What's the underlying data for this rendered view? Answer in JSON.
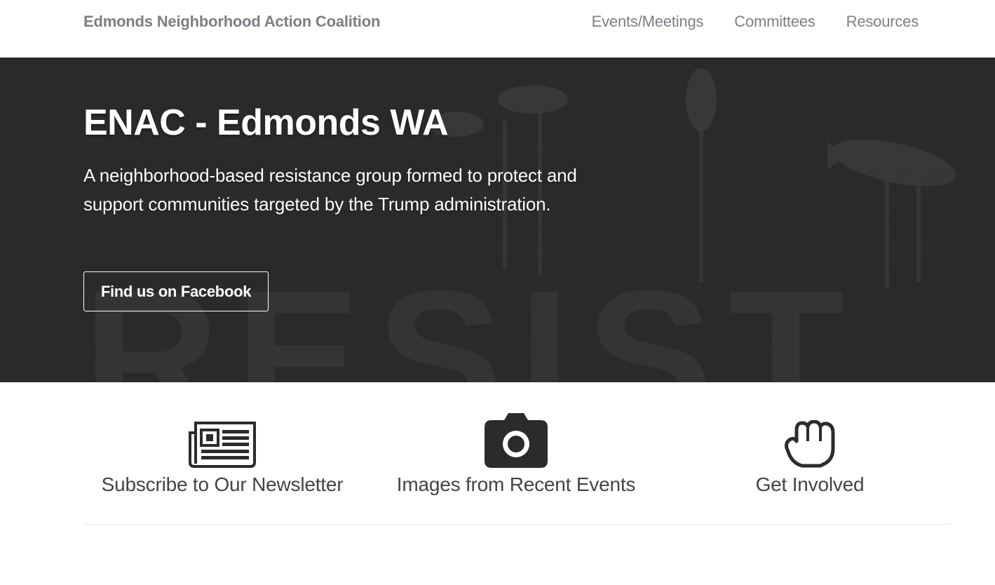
{
  "navbar": {
    "brand": "Edmonds Neighborhood Action Coalition",
    "links": [
      "Events/Meetings",
      "Committees",
      "Resources"
    ]
  },
  "hero": {
    "title": "ENAC - Edmonds WA",
    "subtitle": "A neighborhood-based resistance group formed to protect and support communities targeted by the Trump administration.",
    "button_label": "Find us on Facebook",
    "background_text": "RESIST"
  },
  "features": [
    {
      "label": "Subscribe to Our Newsletter",
      "icon": "newspaper-icon"
    },
    {
      "label": "Images from Recent Events",
      "icon": "camera-icon"
    },
    {
      "label": "Get Involved",
      "icon": "hand-fist-icon"
    }
  ],
  "colors": {
    "hero_background": "#2b2b2b",
    "nav_text": "#7b7f84",
    "icon": "#2b2b2b"
  }
}
